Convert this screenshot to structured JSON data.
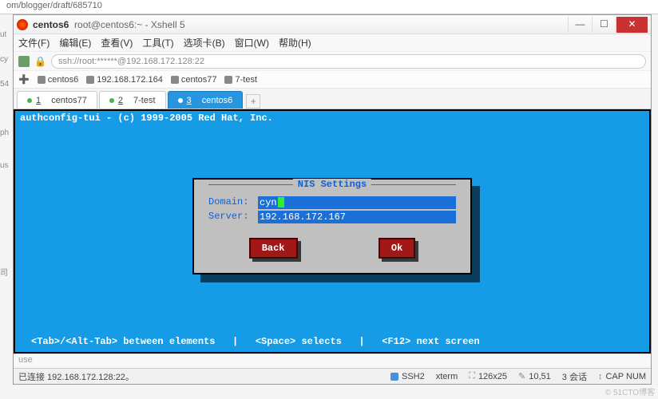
{
  "browser_url": "om/blogger/draft/685710",
  "left_labels": [
    "ut",
    "cy",
    "54",
    "ph",
    "us",
    "司"
  ],
  "window": {
    "title_main": "centos6",
    "title_sub": "root@centos6:~ - Xshell 5"
  },
  "menu": [
    "文件(F)",
    "编辑(E)",
    "查看(V)",
    "工具(T)",
    "选项卡(B)",
    "窗口(W)",
    "帮助(H)"
  ],
  "address": "ssh://root:******@192.168.172.128:22",
  "bookmarks": [
    "centos6",
    "192.168.172.164",
    "centos77",
    "7-test"
  ],
  "tabs": [
    {
      "n": "1",
      "label": "centos77"
    },
    {
      "n": "2",
      "label": "7-test"
    },
    {
      "n": "3",
      "label": "centos6"
    }
  ],
  "terminal": {
    "header": "authconfig-tui - (c) 1999-2005 Red Hat, Inc.",
    "footer": "<Tab>/<Alt-Tab> between elements   |   <Space> selects   |   <F12> next screen"
  },
  "dialog": {
    "title": "NIS Settings",
    "domain_label": "Domain:",
    "domain_value": "cyn",
    "server_label": "Server:",
    "server_value": "192.168.172.167",
    "back": "Back",
    "ok": "Ok"
  },
  "prompt": "use",
  "status": {
    "connected": "已连接 192.168.172.128:22。",
    "ssh": "SSH2",
    "term": "xterm",
    "size": "126x25",
    "cursor": "10,51",
    "sessions": "3 会话",
    "cap": "CAP NUM"
  },
  "watermark": "© 51CTO博客"
}
